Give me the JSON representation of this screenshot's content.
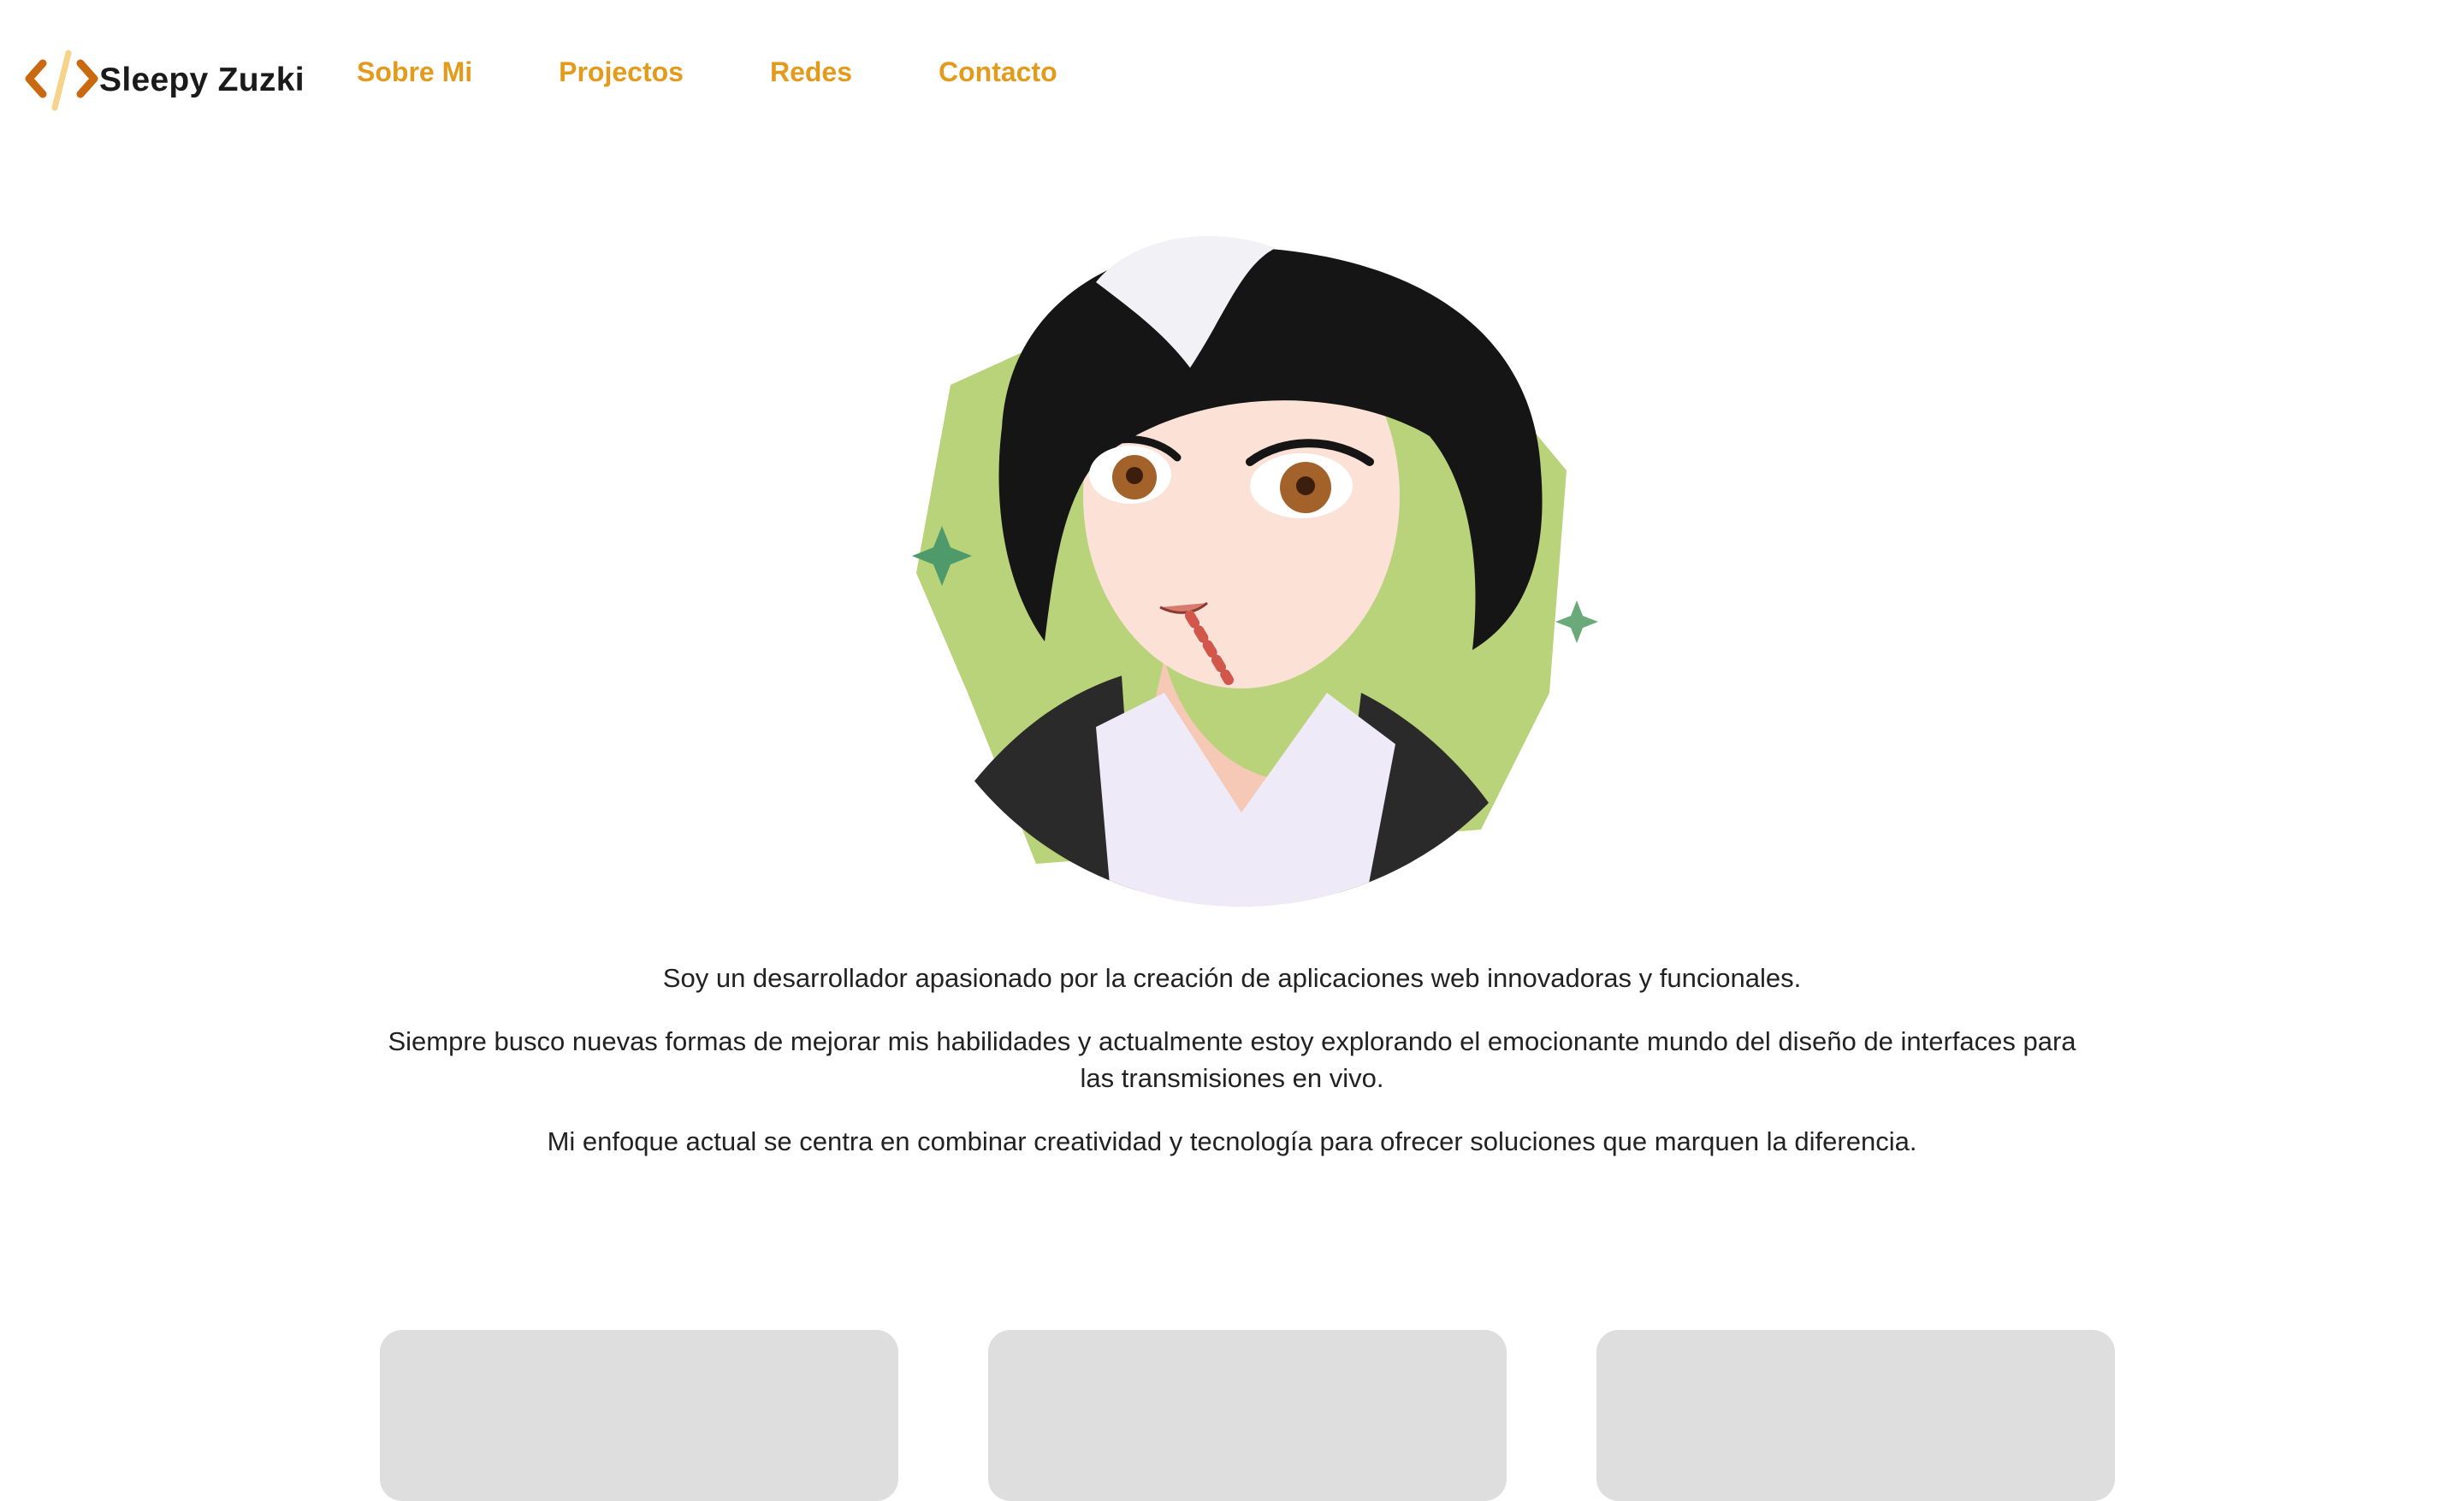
{
  "brand": {
    "name": "Sleepy Zuzki",
    "logo_icon": "code-brackets-icon",
    "colors": {
      "accent": "#e49a1b",
      "logo_dark": "#c96a10",
      "logo_light": "#f7d28a"
    }
  },
  "nav": {
    "items": [
      {
        "label": "Sobre Mi"
      },
      {
        "label": "Projectos"
      },
      {
        "label": "Redes"
      },
      {
        "label": "Contacto"
      }
    ]
  },
  "hero": {
    "avatar_icon": "anime-avatar-illustration",
    "paragraphs": [
      "Soy un desarrollador apasionado por la creación de aplicaciones web innovadoras y funcionales.",
      "Siempre busco nuevas formas de mejorar mis habilidades y actualmente estoy explorando el emocionante mundo del diseño de interfaces para las transmisiones en vivo.",
      "Mi enfoque actual se centra en combinar creatividad y tecnología para ofrecer soluciones que marquen la diferencia."
    ]
  },
  "cards": [
    {
      "state": "loading"
    },
    {
      "state": "loading"
    },
    {
      "state": "loading"
    }
  ]
}
